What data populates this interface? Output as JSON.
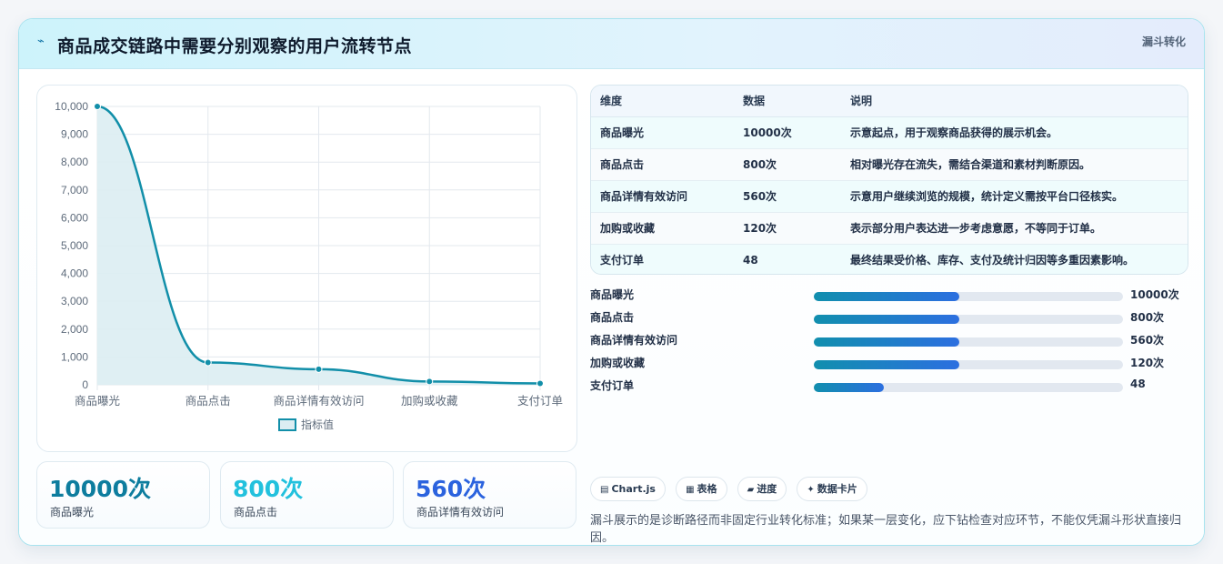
{
  "header": {
    "icon": "spark-icon",
    "title": "商品成交链路中需要分别观察的用户流转节点",
    "tag": "漏斗转化"
  },
  "chart_data": {
    "type": "line",
    "categories": [
      "商品曝光",
      "商品点击",
      "商品详情有效访问",
      "加购或收藏",
      "支付订单"
    ],
    "series": [
      {
        "name": "指标值",
        "values": [
          10000,
          800,
          560,
          120,
          48
        ]
      }
    ],
    "ylim": [
      0,
      10000
    ],
    "yticks": [
      "0",
      "1,000",
      "2,000",
      "3,000",
      "4,000",
      "5,000",
      "6,000",
      "7,000",
      "8,000",
      "9,000",
      "10,000"
    ],
    "title": "",
    "xlabel": "",
    "ylabel": "",
    "legend": "bottom",
    "grid": true,
    "line_color": "#128fa9",
    "fill_color": "#dcedf2"
  },
  "stats": [
    {
      "value": "10000次",
      "label": "商品曝光",
      "color": "#0d7d9e"
    },
    {
      "value": "800次",
      "label": "商品点击",
      "color": "#22c1dd"
    },
    {
      "value": "560次",
      "label": "商品详情有效访问",
      "color": "#2b63de"
    }
  ],
  "table": {
    "headers": [
      "维度",
      "数据",
      "说明"
    ],
    "rows": [
      [
        "商品曝光",
        "10000次",
        "示意起点，用于观察商品获得的展示机会。"
      ],
      [
        "商品点击",
        "800次",
        "相对曝光存在流失，需结合渠道和素材判断原因。"
      ],
      [
        "商品详情有效访问",
        "560次",
        "示意用户继续浏览的规模，统计定义需按平台口径核实。"
      ],
      [
        "加购或收藏",
        "120次",
        "表示部分用户表达进一步考虑意愿，不等同于订单。"
      ],
      [
        "支付订单",
        "48",
        "最终结果受价格、库存、支付及统计归因等多重因素影响。"
      ]
    ]
  },
  "progress": [
    {
      "label": "商品曝光",
      "value": "10000次",
      "fill": 0.47
    },
    {
      "label": "商品点击",
      "value": "800次",
      "fill": 0.47
    },
    {
      "label": "商品详情有效访问",
      "value": "560次",
      "fill": 0.47
    },
    {
      "label": "加购或收藏",
      "value": "120次",
      "fill": 0.47
    },
    {
      "label": "支付订单",
      "value": "48",
      "fill": 0.227
    }
  ],
  "chips": [
    {
      "icon": "▤",
      "label": "Chart.js"
    },
    {
      "icon": "▦",
      "label": "表格"
    },
    {
      "icon": "▰",
      "label": "进度"
    },
    {
      "icon": "✦",
      "label": "数据卡片"
    }
  ],
  "note": "漏斗展示的是诊断路径而非固定行业转化标准；如果某一层变化，应下钻检查对应环节，不能仅凭漏斗形状直接归因。"
}
